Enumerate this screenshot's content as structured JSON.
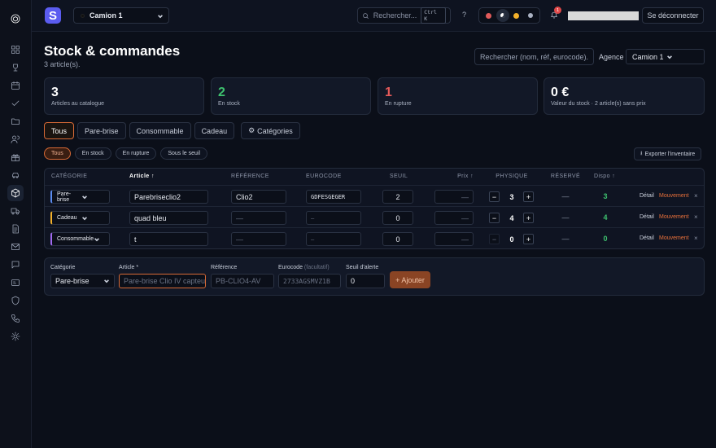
{
  "topbar": {
    "truck_select": "Camion 1",
    "search_placeholder": "Rechercher...",
    "search_shortcut": "Ctrl K",
    "help": "?",
    "notification_count": "1",
    "logout_label": "Se déconnecter"
  },
  "colors": {
    "accent": "#d86a36",
    "brand": "#5b5cf0",
    "positive": "#3ec26f",
    "negative": "#e55a5a",
    "theme_dots": [
      "#e05a5a",
      "#ffffff",
      "#f2b02a",
      "#aab2c2"
    ]
  },
  "header": {
    "title": "Stock & commandes",
    "subtitle": "3 article(s).",
    "search_placeholder": "Rechercher (nom, réf, eurocode).",
    "agence_label": "Agence",
    "agence_value": "Camion 1"
  },
  "kpis": [
    {
      "value": "3",
      "label": "Articles au catalogue"
    },
    {
      "value": "2",
      "label": "En stock"
    },
    {
      "value": "1",
      "label": "En rupture"
    },
    {
      "value": "0 €",
      "label": "Valeur du stock · 2 article(s) sans prix"
    }
  ],
  "tabs": [
    "Tous",
    "Pare-brise",
    "Consommable",
    "Cadeau",
    "Catégories"
  ],
  "filters": [
    "Tous",
    "En stock",
    "En rupture",
    "Sous le seuil"
  ],
  "export_label": "Exporter l'inventaire",
  "table": {
    "headers": [
      "CATÉGORIE",
      "Article",
      "RÉFÉRENCE",
      "EUROCODE",
      "SEUIL",
      "Prix",
      "PHYSIQUE",
      "RÉSERVÉ",
      "Dispo"
    ],
    "rows": [
      {
        "category": "Pare-brise",
        "article": "Parebriseclio2",
        "reference": "Clio2",
        "eurocode": "GDFESGEGER",
        "seuil": "2",
        "prix": "—",
        "physique": "3",
        "reserve": "—",
        "dispo": "3"
      },
      {
        "category": "Cadeau",
        "article": "quad bleu",
        "reference": "—",
        "eurocode": "—",
        "seuil": "0",
        "prix": "—",
        "physique": "4",
        "reserve": "—",
        "dispo": "4"
      },
      {
        "category": "Consommable",
        "article": "t",
        "reference": "—",
        "eurocode": "—",
        "seuil": "0",
        "prix": "—",
        "physique": "0",
        "reserve": "—",
        "dispo": "0"
      }
    ],
    "action_detail": "Détail",
    "action_mouvement": "Mouvement",
    "action_delete": "×"
  },
  "add_form": {
    "category_label": "Catégorie",
    "category_value": "Pare-brise",
    "article_label": "Article *",
    "article_placeholder": "Pare-brise Clio IV capteu",
    "reference_label": "Référence",
    "reference_placeholder": "PB-CLIO4-AV",
    "eurocode_label": "Eurocode",
    "eurocode_optional": "(facultatif)",
    "eurocode_placeholder": "2733AGSMVZ1B",
    "seuil_label": "Seuil d'alerte",
    "seuil_value": "0",
    "add_button": "+ Ajouter"
  }
}
